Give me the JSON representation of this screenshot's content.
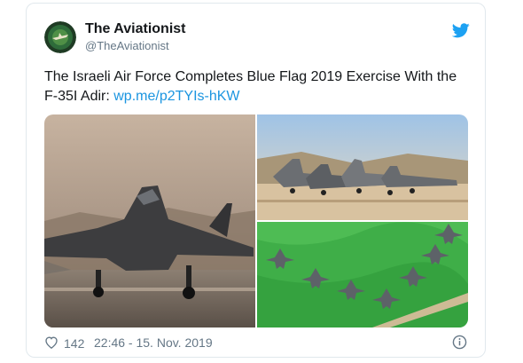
{
  "tweet": {
    "author_name": "The Aviationist",
    "author_handle": "@TheAviationist",
    "text": "The Israeli Air Force Completes Blue Flag 2019 Exercise With the F-35I Adir: ",
    "link": "wp.me/p2TYIs-hKW",
    "like_count": "142",
    "timestamp": "22:46 - 15. Nov. 2019",
    "icons": {
      "platform": "twitter-bird-icon",
      "like": "heart-icon",
      "info": "info-icon"
    },
    "colors": {
      "link": "#1b95e0",
      "bird": "#1da1f2",
      "secondary_text": "#657786"
    },
    "media": [
      {
        "name": "F-35I jet takeoff photo"
      },
      {
        "name": "Jets lined up on tarmac photo"
      },
      {
        "name": "Jets in formation over green field photo"
      }
    ]
  }
}
